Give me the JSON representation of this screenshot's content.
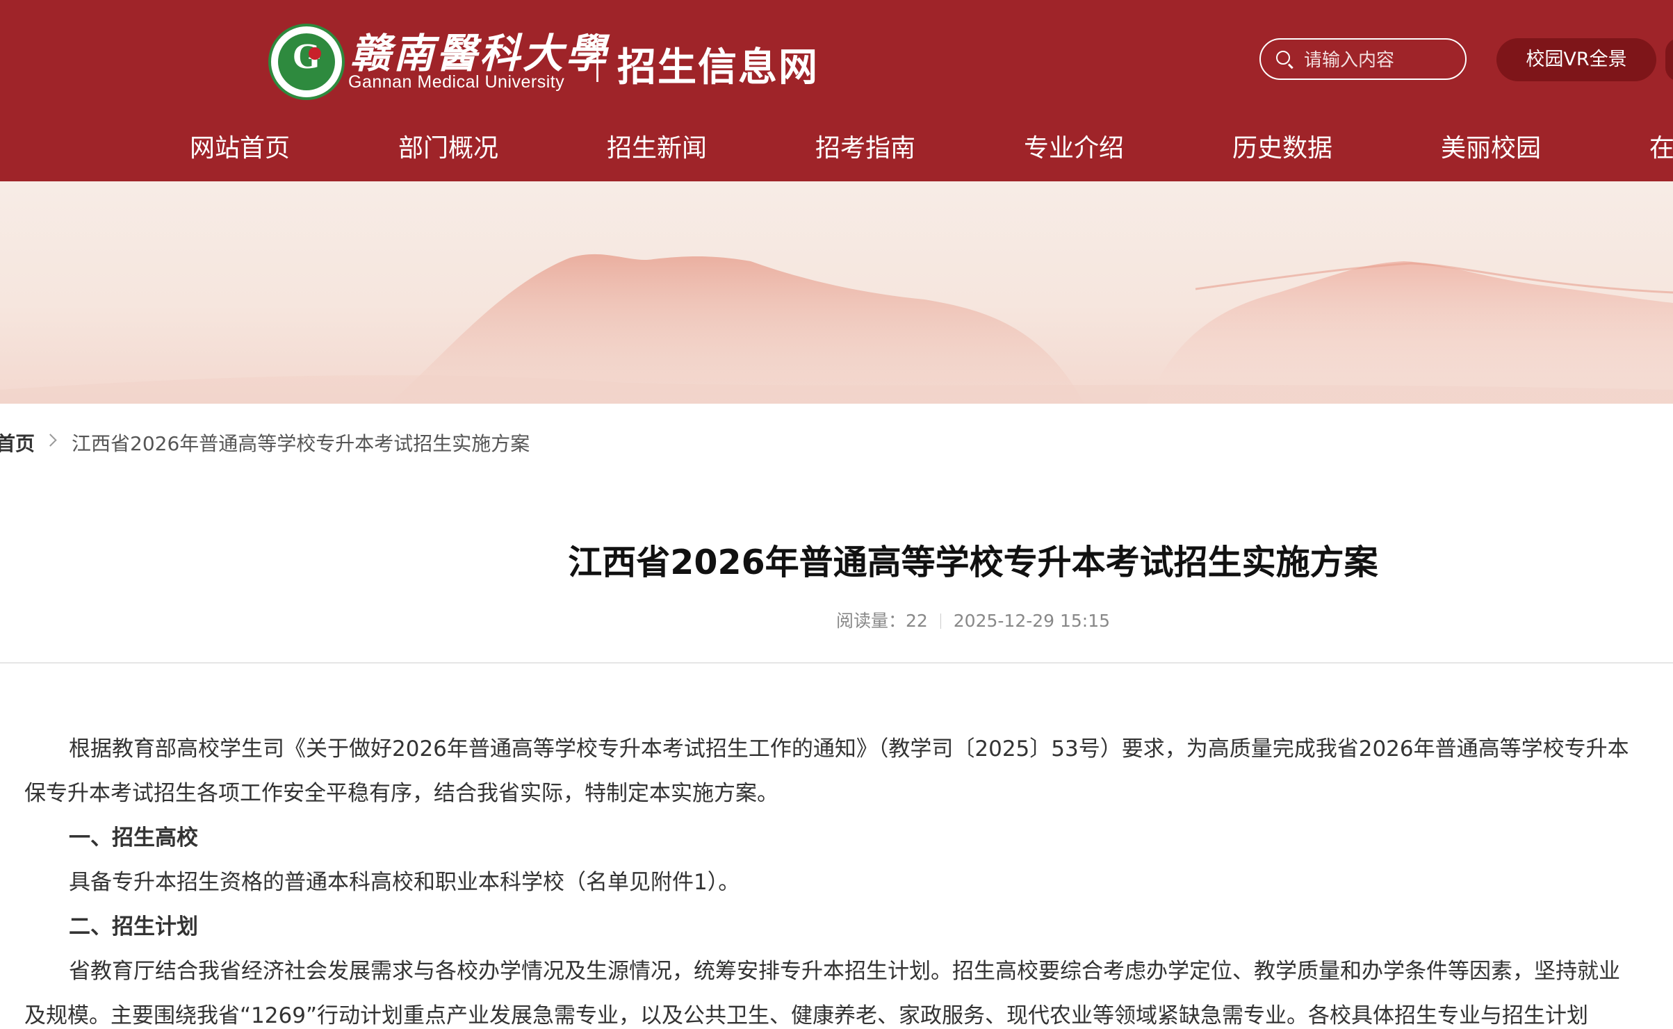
{
  "header": {
    "logo_cn": "赣南醫科大學",
    "logo_en": "Gannan Medical University",
    "site_title": "招生信息网",
    "search_placeholder": "请输入内容",
    "vr_button": "校园VR全景"
  },
  "nav": {
    "items": [
      "网站首页",
      "部门概况",
      "招生新闻",
      "招考指南",
      "专业介绍",
      "历史数据",
      "美丽校园",
      "在"
    ]
  },
  "breadcrumb": {
    "home": "首页",
    "current": "江西省2026年普通高等学校专升本考试招生实施方案"
  },
  "article": {
    "title": "江西省2026年普通高等学校专升本考试招生实施方案",
    "read_label": "阅读量：",
    "read_count": "22",
    "date": "2025-12-29 15:15",
    "lines": [
      "根据教育部高校学生司《关于做好2026年普通高等学校专升本考试招生工作的通知》（教学司〔2025〕53号）要求，为高质量完成我省2026年普通高等学校专升本",
      "保专升本考试招生各项工作安全平稳有序，结合我省实际，特制定本实施方案。",
      "一、招生高校",
      "具备专升本招生资格的普通本科高校和职业本科学校（名单见附件1）。",
      "二、招生计划",
      "省教育厅结合我省经济社会发展需求与各校办学情况及生源情况，统筹安排专升本招生计划。招生高校要综合考虑办学定位、教学质量和办学条件等因素，坚持就业",
      "及规模。主要围绕我省“1269”行动计划重点产业发展急需专业，以及公共卫生、健康养老、家政服务、现代农业等领域紧缺急需专业。各校具体招生专业与招生计划"
    ]
  },
  "colors": {
    "header_bg": "#9f2429",
    "vr_button_bg": "#7e1519",
    "logo_green": "#2e8a3e"
  }
}
